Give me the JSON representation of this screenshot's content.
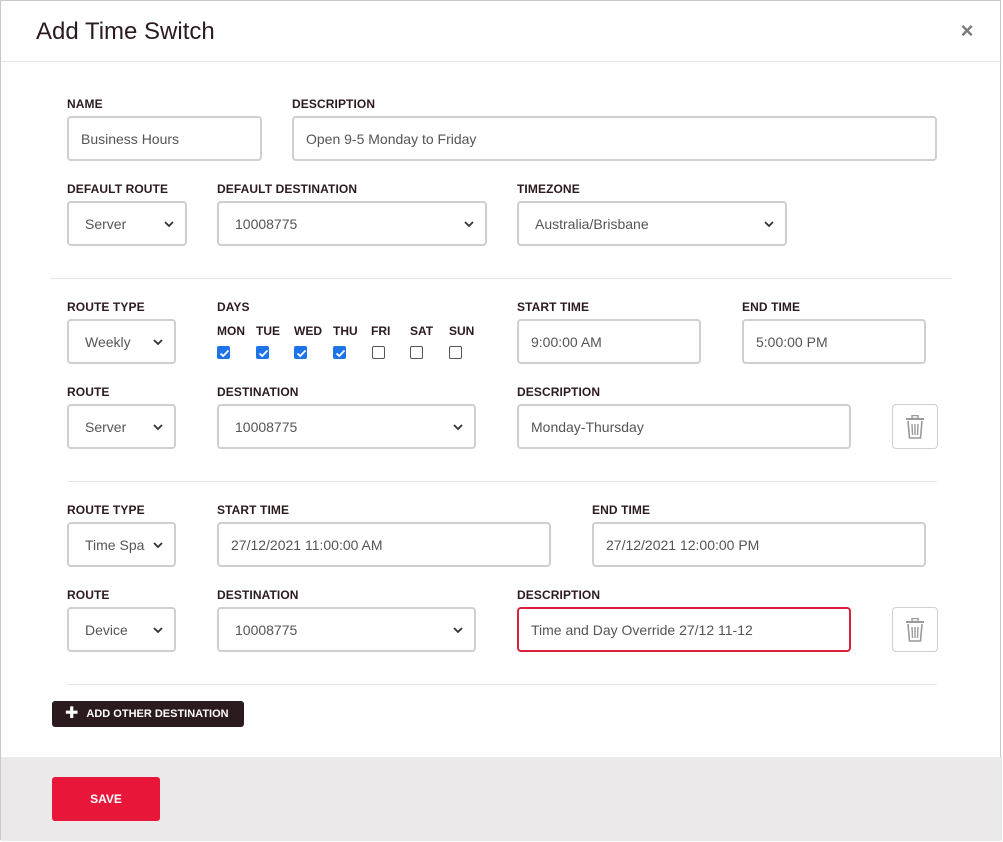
{
  "dialog": {
    "title": "Add Time Switch",
    "close_symbol": "×"
  },
  "general": {
    "name_label": "NAME",
    "name_value": "Business Hours",
    "description_label": "DESCRIPTION",
    "description_value": "Open 9-5 Monday to Friday",
    "default_route_label": "DEFAULT ROUTE",
    "default_route_value": "Server",
    "default_destination_label": "DEFAULT DESTINATION",
    "default_destination_value": "10008775",
    "timezone_label": "TIMEZONE",
    "timezone_value": "Australia/Brisbane"
  },
  "rule1": {
    "route_type_label": "ROUTE TYPE",
    "route_type_value": "Weekly",
    "days_label": "DAYS",
    "days": [
      {
        "label": "MON",
        "checked": true
      },
      {
        "label": "TUE",
        "checked": true
      },
      {
        "label": "WED",
        "checked": true
      },
      {
        "label": "THU",
        "checked": true
      },
      {
        "label": "FRI",
        "checked": false
      },
      {
        "label": "SAT",
        "checked": false
      },
      {
        "label": "SUN",
        "checked": false
      }
    ],
    "start_time_label": "START TIME",
    "start_time_value": "9:00:00 AM",
    "end_time_label": "END TIME",
    "end_time_value": "5:00:00 PM",
    "route_label": "ROUTE",
    "route_value": "Server",
    "destination_label": "DESTINATION",
    "destination_value": "10008775",
    "description_label": "DESCRIPTION",
    "description_value": "Monday-Thursday"
  },
  "rule2": {
    "route_type_label": "ROUTE TYPE",
    "route_type_value": "Time Spa",
    "start_time_label": "START TIME",
    "start_time_value": "27/12/2021 11:00:00 AM",
    "end_time_label": "END TIME",
    "end_time_value": "27/12/2021 12:00:00 PM",
    "route_label": "ROUTE",
    "route_value": "Device",
    "destination_label": "DESTINATION",
    "destination_value": "10008775",
    "description_label": "DESCRIPTION",
    "description_value": "Time and Day Override 27/12 11-12"
  },
  "actions": {
    "add_label": "ADD OTHER DESTINATION",
    "add_icon": "plus-icon",
    "save_label": "SAVE"
  },
  "colors": {
    "brand_dark": "#2b1a1e",
    "save_red": "#e8173a",
    "checkbox_blue": "#1f73e8",
    "invalid_border": "#d9203c"
  }
}
